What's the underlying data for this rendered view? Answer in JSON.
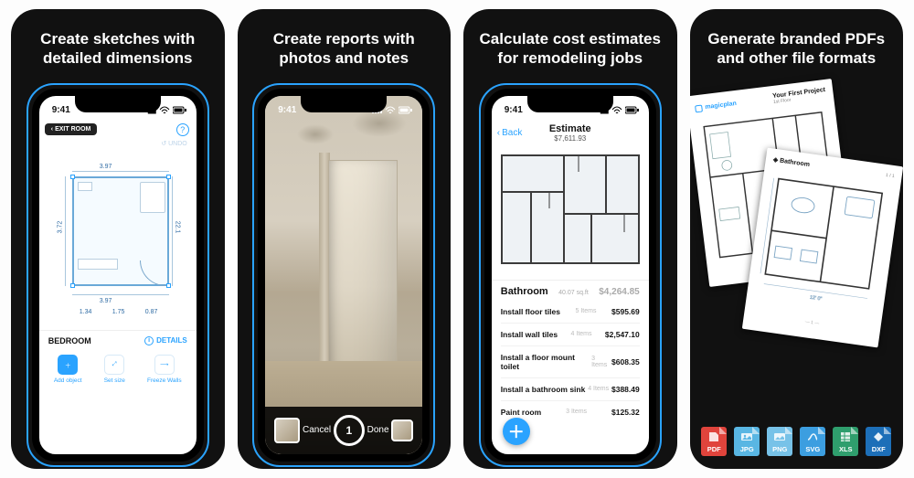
{
  "colors": {
    "accent": "#2aa3ff",
    "dark": "#111111"
  },
  "cards": [
    {
      "headline": "Create sketches with detailed dimensions"
    },
    {
      "headline": "Create reports with photos and notes"
    },
    {
      "headline": "Calculate cost estimates for remodeling jobs"
    },
    {
      "headline": "Generate branded PDFs and other file formats"
    }
  ],
  "statusbar": {
    "time": "9:41"
  },
  "card1": {
    "exit_label": "EXIT ROOM",
    "undo_label": "UNDO",
    "room_name": "BEDROOM",
    "details_label": "DETAILS",
    "dimensions": {
      "top": "3.97",
      "left": "3.72",
      "right": "22.1",
      "bottom": "3.97",
      "sub": [
        "1.34",
        "1.75",
        "0.87"
      ]
    },
    "actions": [
      {
        "label": "Add object"
      },
      {
        "label": "Set size"
      },
      {
        "label": "Freeze Walls"
      }
    ]
  },
  "card2": {
    "cancel_label": "Cancel",
    "done_label": "Done",
    "shot_count": "1"
  },
  "card3": {
    "back_label": "Back",
    "title": "Estimate",
    "total": "$7,611.93",
    "section": {
      "name": "Bathroom",
      "meta": "40.07 sq.ft",
      "amount": "$4,264.85"
    },
    "items": [
      {
        "name": "Install floor tiles",
        "meta": "5 Items",
        "price": "$595.69"
      },
      {
        "name": "Install wall tiles",
        "meta": "4 Items",
        "price": "$2,547.10"
      },
      {
        "name": "Install a floor mount toilet",
        "meta": "3 Items",
        "price": "$608.35"
      },
      {
        "name": "Install a bathroom sink",
        "meta": "4 Items",
        "price": "$388.49"
      },
      {
        "name": "Paint room",
        "meta": "3 Items",
        "price": "$125.32"
      }
    ]
  },
  "card4": {
    "brand": "magicplan",
    "doc_title": "Your First Project",
    "doc_sub": "1st Floor",
    "section_label": "Bathroom",
    "formats": [
      "PDF",
      "JPG",
      "PNG",
      "SVG",
      "XLS",
      "DXF"
    ]
  }
}
